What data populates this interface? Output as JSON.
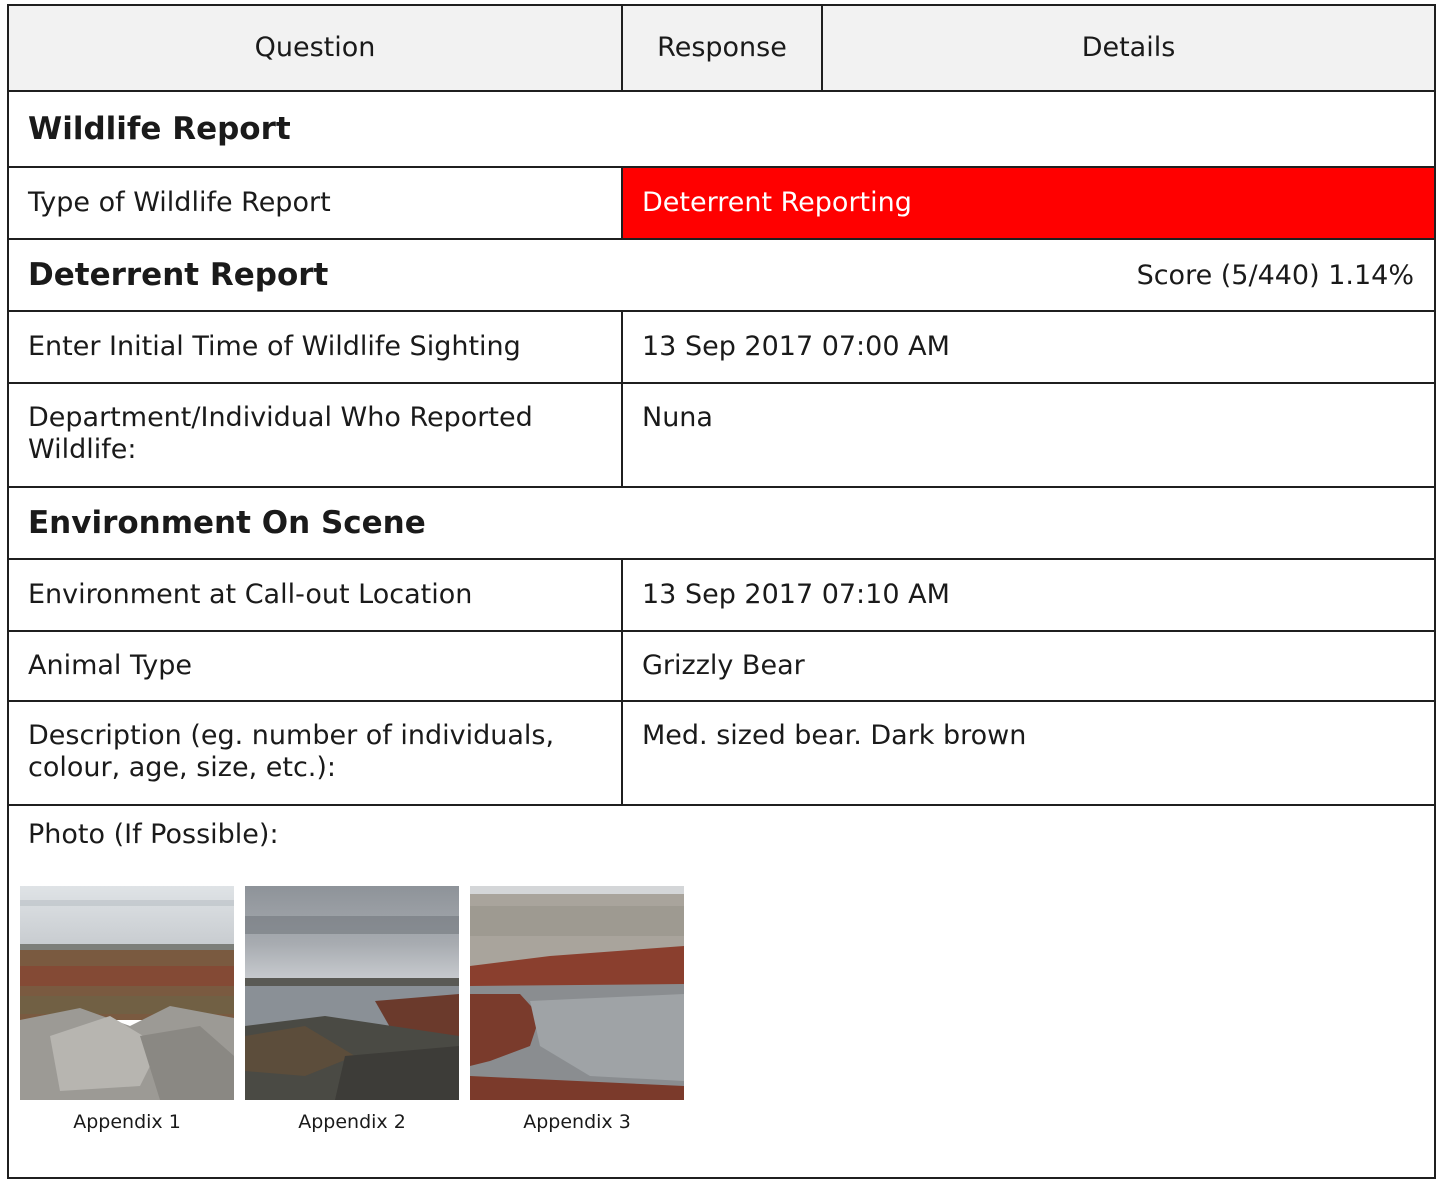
{
  "header": {
    "question": "Question",
    "response": "Response",
    "details": "Details"
  },
  "sections": {
    "wildlife_report": "Wildlife Report",
    "deterrent_report": "Deterrent Report",
    "deterrent_score": "Score (5/440) 1.14%",
    "environment_on_scene": "Environment On Scene"
  },
  "rows": {
    "type_of_report": {
      "question": "Type of Wildlife Report",
      "response": "Deterrent Reporting",
      "response_color": "#ff0000"
    },
    "initial_time": {
      "question": "Enter Initial Time of Wildlife Sighting",
      "response": "13 Sep 2017 07:00 AM"
    },
    "reported_by": {
      "question_line1": "Department/Individual Who Reported",
      "question_line2": "Wildlife:",
      "response": "Nuna"
    },
    "env_callout": {
      "question": "Environment at Call-out Location",
      "response": "13 Sep 2017 07:10 AM"
    },
    "animal_type": {
      "question": "Animal Type",
      "response": "Grizzly Bear"
    },
    "description": {
      "question_line1": "Description (eg. number of individuals,",
      "question_line2": "colour, age, size, etc.):",
      "response": "Med. sized bear. Dark brown"
    }
  },
  "photos": {
    "label": "Photo (If Possible):",
    "items": [
      {
        "caption": "Appendix 1"
      },
      {
        "caption": "Appendix 2"
      },
      {
        "caption": "Appendix 3"
      }
    ]
  }
}
